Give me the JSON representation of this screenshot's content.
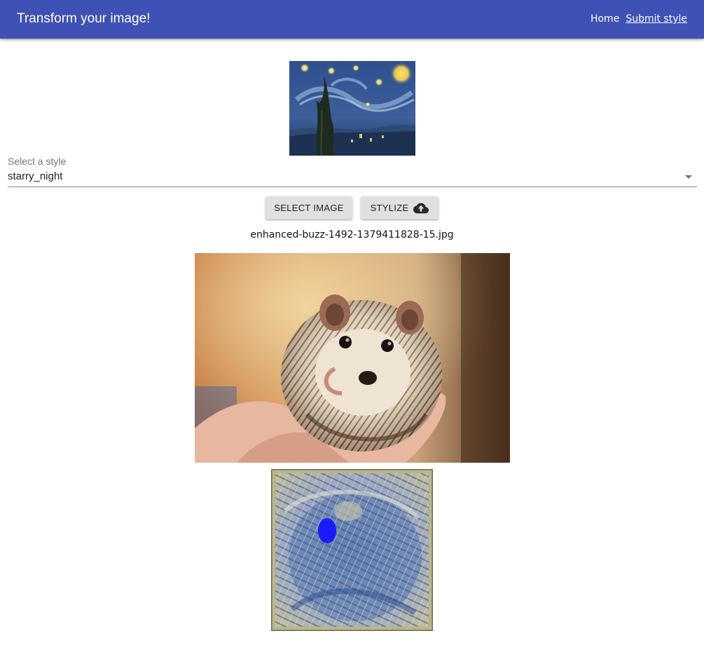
{
  "header": {
    "title": "Transform your image!",
    "nav": [
      {
        "label": "Home",
        "active": false
      },
      {
        "label": "Submit style",
        "active": true
      }
    ],
    "color": "#3f51b5"
  },
  "style_preview": {
    "icon": "starry-night-painting"
  },
  "style_select": {
    "label": "Select a style",
    "value": "starry_night"
  },
  "buttons": {
    "select_image": "SELECT IMAGE",
    "stylize": "STYLIZE",
    "stylize_icon": "cloud-upload-icon"
  },
  "file": {
    "name": "enhanced-buzz-1492-1379411828-15.jpg"
  },
  "images": {
    "input": "hedgehog-in-hand-photo",
    "output": "stylized-result-image"
  }
}
